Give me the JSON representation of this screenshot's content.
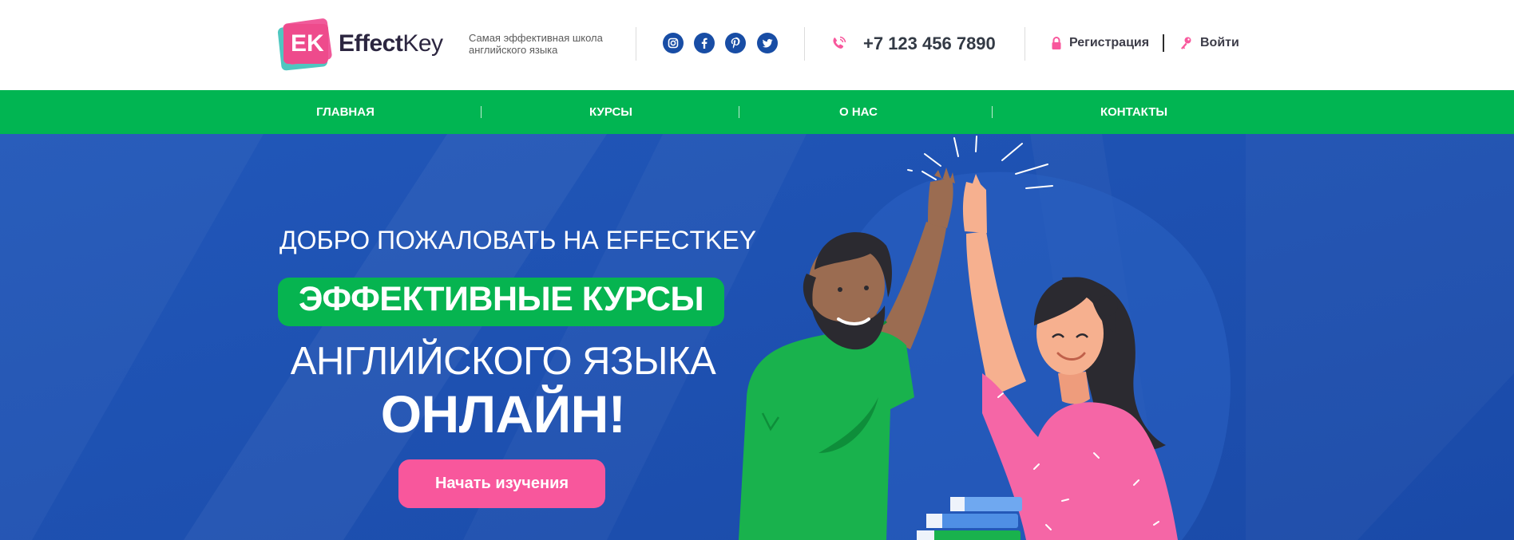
{
  "brand": {
    "logo_mark": "EK",
    "name_bold": "Effect",
    "name_light": "Key",
    "tagline": "Самая эффективная школа английского языка"
  },
  "social": [
    {
      "icon": "instagram-icon"
    },
    {
      "icon": "facebook-icon"
    },
    {
      "icon": "pinterest-icon"
    },
    {
      "icon": "twitter-icon"
    }
  ],
  "contact": {
    "phone": "+7 123 456 7890",
    "phone_icon": "phone-icon"
  },
  "auth": {
    "register_label": "Регистрация",
    "login_label": "Войти"
  },
  "nav": {
    "items": [
      {
        "label": "ГЛАВНАЯ"
      },
      {
        "label": "КУРСЫ"
      },
      {
        "label": "О НАС"
      },
      {
        "label": "КОНТАКТЫ"
      }
    ]
  },
  "hero": {
    "welcome": "ДОБРО ПОЖАЛОВАТЬ НА EFFECTKEY",
    "highlight": "ЭФФЕКТИВНЫЕ КУРСЫ",
    "line2": "АНГЛИЙСКОГО ЯЗЫКА",
    "line3": "ОНЛАЙН!",
    "cta_label": "Начать изучения"
  },
  "colors": {
    "accent_green": "#01b552",
    "hero_blue": "#1e53b5",
    "cta_pink": "#f8579c",
    "social_blue": "#184da5"
  }
}
